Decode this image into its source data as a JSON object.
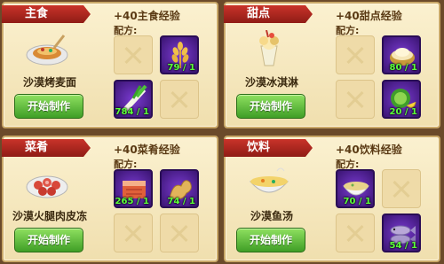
{
  "panels": [
    {
      "category": "主食",
      "exp": "+40主食经验",
      "recipe_label": "配方:",
      "dish": "沙漠烤麦面",
      "button": "开始制作",
      "slots": [
        {
          "filled": false
        },
        {
          "filled": true,
          "icon": "wheat-icon",
          "count": "79 / 1"
        },
        {
          "filled": true,
          "icon": "green-onion-icon",
          "count": "784 / 1"
        },
        {
          "filled": false
        }
      ]
    },
    {
      "category": "甜点",
      "exp": "+40甜点经验",
      "recipe_label": "配方:",
      "dish": "沙漠冰淇淋",
      "button": "开始制作",
      "slots": [
        {
          "filled": false
        },
        {
          "filled": true,
          "icon": "flour-bowl-icon",
          "count": "80 / 1"
        },
        {
          "filled": false
        },
        {
          "filled": true,
          "icon": "melon-icon",
          "count": "20 / 1"
        }
      ]
    },
    {
      "category": "菜肴",
      "exp": "+40菜肴经验",
      "recipe_label": "配方:",
      "dish": "沙漠火腿肉皮冻",
      "button": "开始制作",
      "slots": [
        {
          "filled": true,
          "icon": "ham-icon",
          "count": "265 / 1"
        },
        {
          "filled": true,
          "icon": "ginger-icon",
          "count": "74 / 1"
        },
        {
          "filled": false
        },
        {
          "filled": false
        }
      ]
    },
    {
      "category": "饮料",
      "exp": "+40饮料经验",
      "recipe_label": "配方:",
      "dish": "沙漠鱼汤",
      "button": "开始制作",
      "slots": [
        {
          "filled": true,
          "icon": "soup-bowl-icon",
          "count": "70 / 1"
        },
        {
          "filled": false
        },
        {
          "filled": false
        },
        {
          "filled": true,
          "icon": "fish-icon",
          "count": "54 / 1"
        }
      ]
    }
  ]
}
